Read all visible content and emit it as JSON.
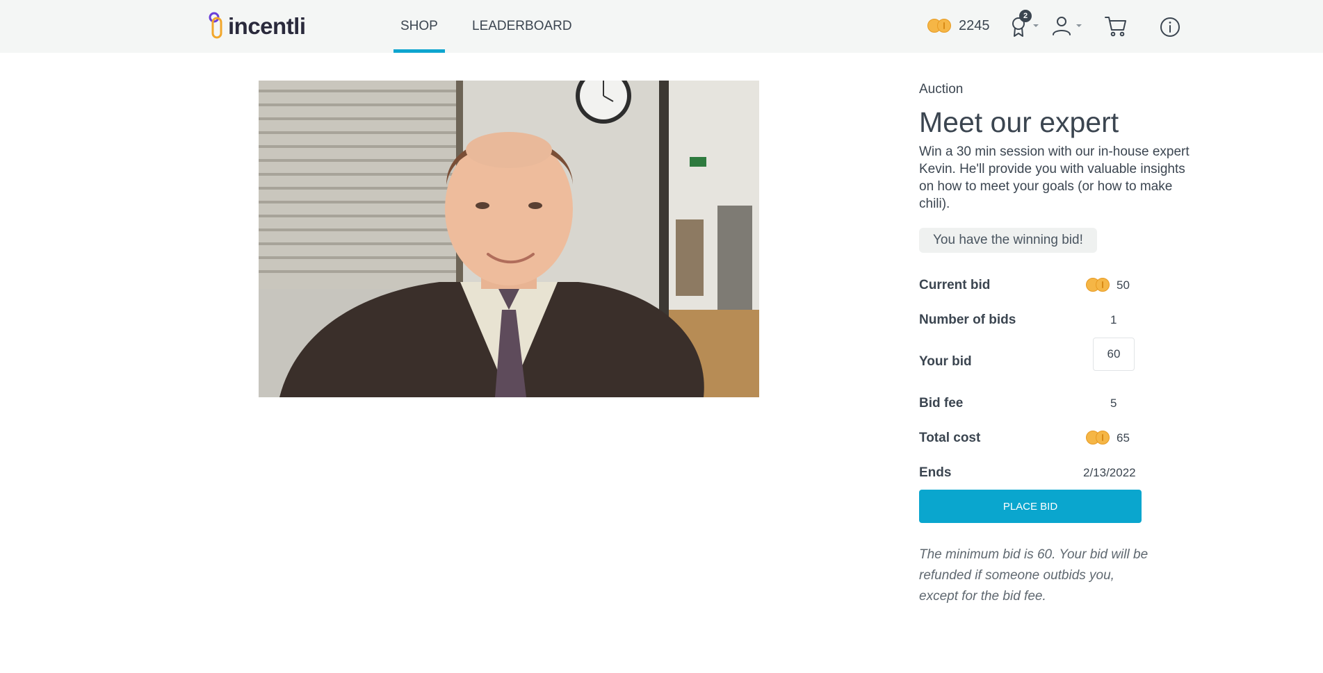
{
  "header": {
    "logo_text": "incentli",
    "tabs": [
      {
        "label": "SHOP",
        "active": true
      },
      {
        "label": "LEADERBOARD",
        "active": false
      }
    ],
    "coin_balance": "2245",
    "achievements_badge": "2",
    "icons": [
      "coin-icon",
      "award-icon",
      "user-icon",
      "cart-icon",
      "info-icon"
    ]
  },
  "product": {
    "category": "Auction",
    "title": "Meet our expert",
    "description": "Win a 30 min session with our in-house expert Kevin. He'll provide you with valuable insights on how to meet your goals (or how to make chili).",
    "status": "You have the winning bid!"
  },
  "bid_details": {
    "current_bid_label": "Current bid",
    "current_bid_value": "50",
    "num_bids_label": "Number of bids",
    "num_bids_value": "1",
    "your_bid_label": "Your bid",
    "your_bid_value": "60",
    "bid_fee_label": "Bid fee",
    "bid_fee_value": "5",
    "total_cost_label": "Total cost",
    "total_cost_value": "65",
    "ends_label": "Ends",
    "ends_value": "2/13/2022"
  },
  "actions": {
    "place_bid_label": "PLACE BID"
  },
  "note": "The minimum bid is 60. Your bid will be refunded if someone outbids you, except for the bid fee.",
  "colors": {
    "accent": "#0aa6ce",
    "coin": "#f5b646",
    "header_bg": "#f4f6f5",
    "text": "#3b4550"
  }
}
